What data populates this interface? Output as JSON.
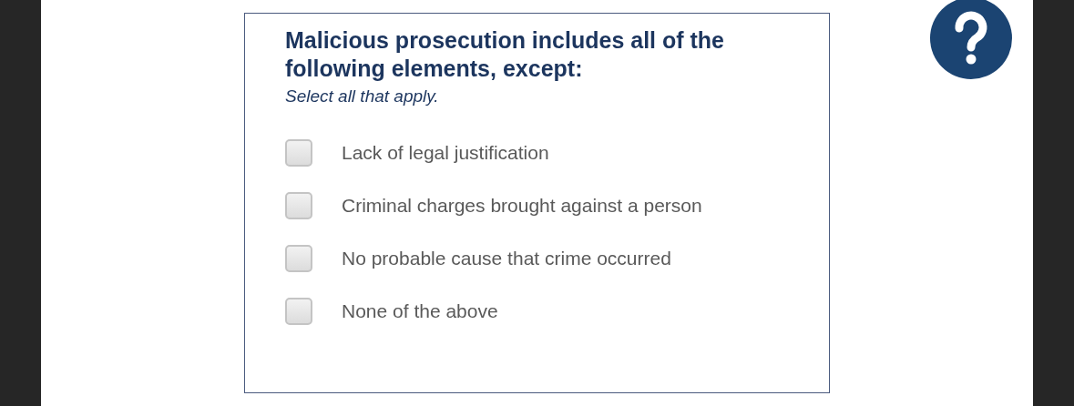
{
  "question": {
    "title": "Malicious prosecution includes all of the following elements, except:",
    "instruction": "Select all that apply."
  },
  "options": [
    {
      "label": "Lack of legal justification",
      "checked": false
    },
    {
      "label": "Criminal charges brought against a person",
      "checked": false
    },
    {
      "label": "No probable cause that crime occurred",
      "checked": false
    },
    {
      "label": "None of the above",
      "checked": false
    }
  ]
}
